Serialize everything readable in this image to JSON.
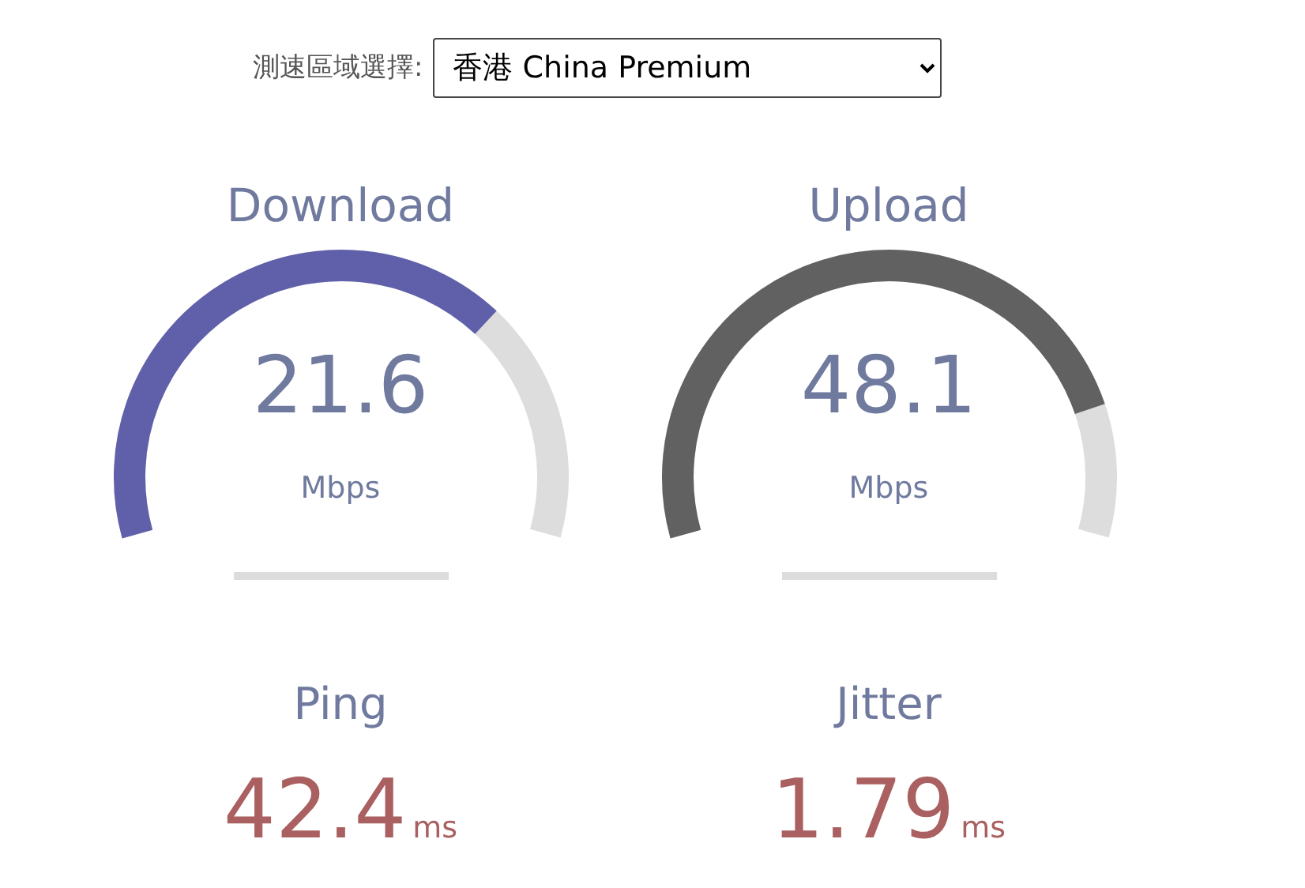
{
  "server_picker": {
    "label": "測速區域選擇:",
    "value": "香港 China Premium"
  },
  "gauges": [
    {
      "title": "Download",
      "value": "21.6",
      "unit": "Mbps",
      "color": "#6060aa"
    },
    {
      "title": "Upload",
      "value": "48.1",
      "unit": "Mbps",
      "color": "#616161"
    }
  ],
  "stats": [
    {
      "title": "Ping",
      "value": "42.4",
      "unit": "ms"
    },
    {
      "title": "Jitter",
      "value": "1.79",
      "unit": "ms"
    }
  ]
}
